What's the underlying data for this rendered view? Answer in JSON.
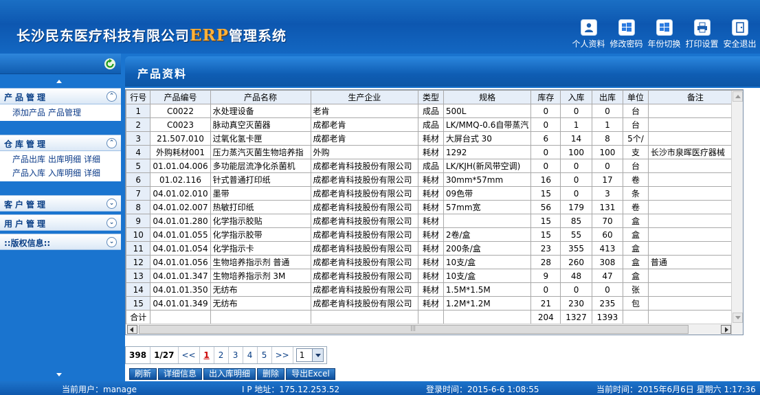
{
  "header": {
    "title_pre": "长沙民东医疗科技有限公司",
    "title_erp": "ERP",
    "title_post": "管理系统",
    "tools": [
      {
        "label": "个人资料",
        "icon": "user-icon"
      },
      {
        "label": "修改密码",
        "icon": "windows-icon"
      },
      {
        "label": "年份切换",
        "icon": "windows-icon"
      },
      {
        "label": "打印设置",
        "icon": "printer-icon"
      },
      {
        "label": "安全退出",
        "icon": "exit-icon"
      }
    ]
  },
  "sidebar": {
    "sections": [
      {
        "title": "产品管理",
        "expanded": true,
        "links": [
          [
            "添加产品",
            "产品管理"
          ]
        ]
      },
      {
        "title": "仓库管理",
        "expanded": true,
        "links": [
          [
            "产品出库",
            "出库明细",
            "详细"
          ],
          [
            "产品入库",
            "入库明细",
            "详细"
          ]
        ]
      },
      {
        "title": "客户管理",
        "expanded": false
      },
      {
        "title": "用户管理",
        "expanded": false
      },
      {
        "title": "::版权信息::",
        "expanded": false
      }
    ]
  },
  "page": {
    "title": "产品资料"
  },
  "table": {
    "columns": [
      "行号",
      "产品编号",
      "产品名称",
      "生产企业",
      "类型",
      "规格",
      "库存",
      "入库",
      "出库",
      "单位",
      "备注"
    ],
    "rows": [
      [
        "1",
        "C0022",
        "水处理设备",
        "老肯",
        "成品",
        "500L",
        "0",
        "0",
        "0",
        "台",
        ""
      ],
      [
        "2",
        "C0023",
        "脉动真空灭菌器",
        "成都老肯",
        "成品",
        "LK/MMQ-0.6自带蒸汽",
        "0",
        "1",
        "1",
        "台",
        ""
      ],
      [
        "3",
        "21.507.010",
        "过氧化氢卡匣",
        "成都老肯",
        "耗材",
        "大屏台式 30",
        "6",
        "14",
        "8",
        "5个/",
        ""
      ],
      [
        "4",
        "外购耗材001",
        "压力蒸汽灭菌生物培养指",
        "外购",
        "耗材",
        "1292",
        "0",
        "100",
        "100",
        "支",
        "长沙市泉晖医疗器械"
      ],
      [
        "5",
        "01.01.04.006",
        "多功能层流净化杀菌机",
        "成都老肯科技股份有限公司",
        "成品",
        "LK/KJH(新风带空调)",
        "0",
        "0",
        "0",
        "台",
        ""
      ],
      [
        "6",
        "01.02.116",
        "针式普通打印纸",
        "成都老肯科技股份有限公司",
        "耗材",
        "30mm*57mm",
        "16",
        "0",
        "17",
        "卷",
        ""
      ],
      [
        "7",
        "04.01.02.010",
        "墨带",
        "成都老肯科技股份有限公司",
        "耗材",
        "09色带",
        "15",
        "0",
        "3",
        "条",
        ""
      ],
      [
        "8",
        "04.01.02.007",
        "热敏打印纸",
        "成都老肯科技股份有限公司",
        "耗材",
        "57mm宽",
        "56",
        "179",
        "131",
        "卷",
        ""
      ],
      [
        "9",
        "04.01.01.280",
        "化学指示胶贴",
        "成都老肯科技股份有限公司",
        "耗材",
        "",
        "15",
        "85",
        "70",
        "盒",
        ""
      ],
      [
        "10",
        "04.01.01.055",
        "化学指示胶带",
        "成都老肯科技股份有限公司",
        "耗材",
        "2卷/盒",
        "15",
        "55",
        "60",
        "盒",
        ""
      ],
      [
        "11",
        "04.01.01.054",
        "化学指示卡",
        "成都老肯科技股份有限公司",
        "耗材",
        "200条/盒",
        "23",
        "355",
        "413",
        "盒",
        ""
      ],
      [
        "12",
        "04.01.01.056",
        "生物培养指示剂 普通",
        "成都老肯科技股份有限公司",
        "耗材",
        "10支/盒",
        "28",
        "260",
        "308",
        "盒",
        "普通"
      ],
      [
        "13",
        "04.01.01.347",
        "生物培养指示剂 3M",
        "成都老肯科技股份有限公司",
        "耗材",
        "10支/盒",
        "9",
        "48",
        "47",
        "盒",
        ""
      ],
      [
        "14",
        "04.01.01.350",
        "无纺布",
        "成都老肯科技股份有限公司",
        "耗材",
        "1.5M*1.5M",
        "0",
        "0",
        "0",
        "张",
        ""
      ],
      [
        "15",
        "04.01.01.349",
        "无纺布",
        "成都老肯科技股份有限公司",
        "耗材",
        "1.2M*1.2M",
        "21",
        "230",
        "235",
        "包",
        ""
      ]
    ],
    "total": [
      "合计",
      "",
      "",
      "",
      "",
      "",
      "204",
      "1327",
      "1393",
      "",
      ""
    ]
  },
  "pager": {
    "total": "398",
    "page_info": "1/27",
    "first": "<<",
    "pages": [
      "1",
      "2",
      "3",
      "4",
      "5"
    ],
    "next": ">>",
    "select_value": "1"
  },
  "actions": [
    "刷新",
    "详细信息",
    "出入库明细",
    "删除",
    "导出Excel"
  ],
  "status": {
    "user": "当前用户：manage",
    "ip": "I P 地址：175.12.253.52",
    "login": "登录时间：2015-6-6 1:08:55",
    "now": "当前时间：2015年6月6日 星期六 1:17:36"
  },
  "colors": {
    "header": "#1367c2",
    "sidebar": "#1a74cf",
    "erp_accent": "#ffb23a",
    "active_page": "#cc0000"
  }
}
